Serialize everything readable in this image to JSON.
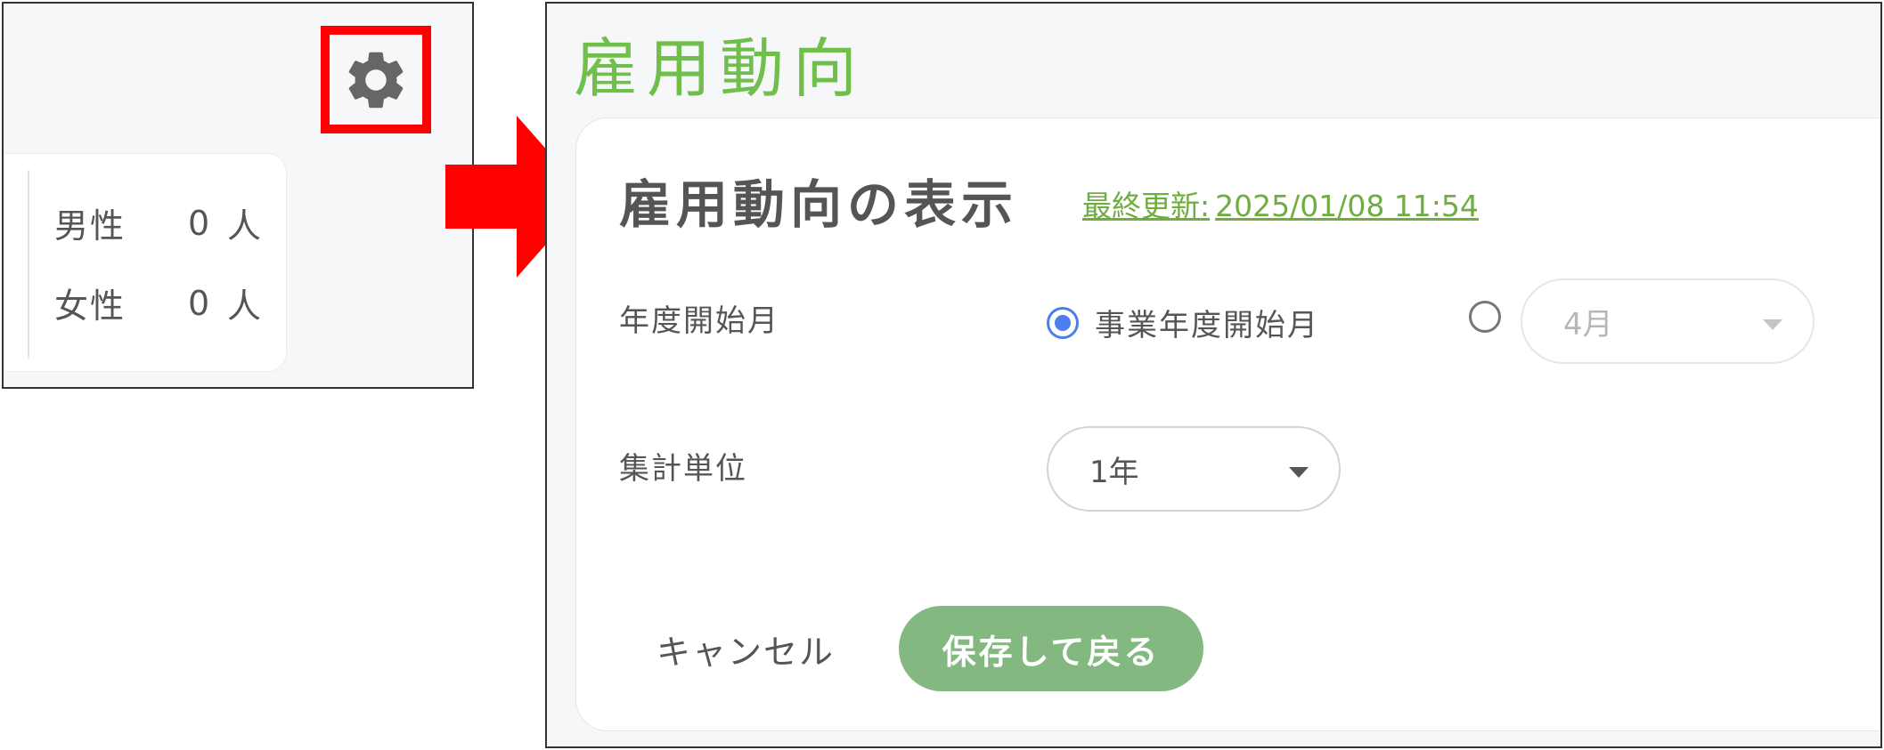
{
  "left_panel": {
    "settings_icon": "gear-icon",
    "highlight_color": "#ff0000",
    "stats": [
      {
        "label": "男性",
        "value": "0",
        "unit": "人"
      },
      {
        "label": "女性",
        "value": "0",
        "unit": "人"
      }
    ]
  },
  "arrow": {
    "icon": "arrow-right-icon",
    "color": "#ff0000"
  },
  "page": {
    "title": "雇用動向",
    "title_color": "#6fbf4a"
  },
  "settings": {
    "heading": "雇用動向の表示",
    "last_updated_label": "最終更新:",
    "last_updated_value": "2025/01/08 11:54",
    "fiscal_start": {
      "label": "年度開始月",
      "option_business": "事業年度開始月",
      "option_business_checked": true,
      "option_custom_checked": false,
      "month_select_value": "4月"
    },
    "aggregation": {
      "label": "集計単位",
      "select_value": "1年"
    }
  },
  "actions": {
    "cancel_label": "キャンセル",
    "save_label": "保存して戻る",
    "save_color": "#83b981"
  },
  "colors": {
    "accent_green": "#6fae3e",
    "radio_blue": "#4c7ef0"
  }
}
